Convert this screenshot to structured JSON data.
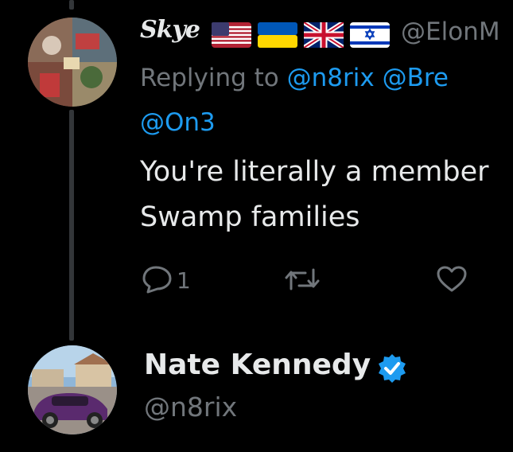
{
  "tweet": {
    "author_name": "Skye",
    "author_handle": "@ElonM",
    "flags": [
      "us-flag-icon",
      "ukraine-flag-icon",
      "uk-flag-icon",
      "israel-flag-icon"
    ],
    "replying_prefix": "Replying to",
    "mentions": [
      "@n8rix",
      "@Bre"
    ],
    "mention_line2": "@On3",
    "body_lines": [
      "You're literally a member",
      "Swamp families"
    ],
    "reply_count": "1"
  },
  "next_tweet": {
    "author_name": "Nate Kennedy",
    "author_handle": "@n8rix",
    "verified": true
  },
  "colors": {
    "background": "#000000",
    "text_primary": "#e7e9ea",
    "text_secondary": "#71767b",
    "accent": "#1d9bf0",
    "thread_line": "#333639"
  }
}
